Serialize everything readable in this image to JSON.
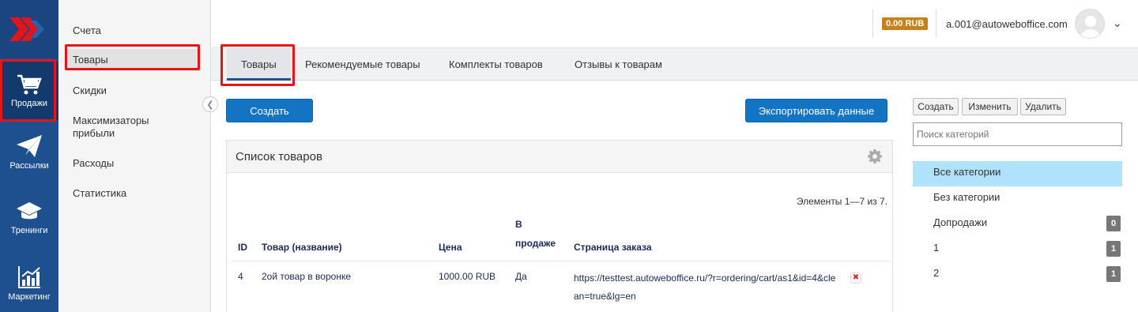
{
  "rail": {
    "items": [
      {
        "label": "Продажи",
        "icon": "cart-icon"
      },
      {
        "label": "Рассылки",
        "icon": "paper-plane-icon"
      },
      {
        "label": "Тренинги",
        "icon": "graduation-cap-icon"
      },
      {
        "label": "Маркетинг",
        "icon": "bar-chart-icon"
      }
    ]
  },
  "submenu": {
    "items": [
      {
        "label": "Счета"
      },
      {
        "label": "Товары"
      },
      {
        "label": "Скидки"
      },
      {
        "label": "Максимизаторы прибыли"
      },
      {
        "label": "Расходы"
      },
      {
        "label": "Статистика"
      }
    ]
  },
  "header": {
    "balance": "0.00 RUB",
    "email": "a.001@autoweboffice.com"
  },
  "tabs": [
    {
      "label": "Товары"
    },
    {
      "label": "Рекомендуемые товары"
    },
    {
      "label": "Комплекты товаров"
    },
    {
      "label": "Отзывы к товарам"
    }
  ],
  "actions": {
    "create": "Создать",
    "export": "Экспортировать данные"
  },
  "panel": {
    "title": "Список товаров",
    "count": "Элементы 1—7 из 7."
  },
  "table": {
    "headers": {
      "id": "ID",
      "name": "Товар (название)",
      "price": "Цена",
      "on_sale": "В продаже",
      "order_page": "Страница заказа"
    },
    "rows": [
      {
        "id": "4",
        "name": "2ой товар в воронке",
        "price": "1000.00 RUB",
        "on_sale": "Да",
        "order_page": "https://testtest.autoweboffice.ru/?r=ordering/cart/as1&id=4&clean=true&lg=en"
      }
    ]
  },
  "categories": {
    "buttons": {
      "create": "Создать",
      "edit": "Изменить",
      "delete": "Удалить"
    },
    "search_placeholder": "Поиск категорий",
    "items": [
      {
        "label": "Все категории",
        "badge": ""
      },
      {
        "label": "Без категории",
        "badge": ""
      },
      {
        "label": "Допродажи",
        "badge": "0"
      },
      {
        "label": "1",
        "badge": "1"
      },
      {
        "label": "2",
        "badge": "1"
      }
    ]
  },
  "colors": {
    "rail": "#1e4f8f",
    "primary_button": "#1474c4",
    "balance_badge": "#c7801a",
    "active_category": "#aee3fb",
    "highlight_box": "#e4141b"
  }
}
